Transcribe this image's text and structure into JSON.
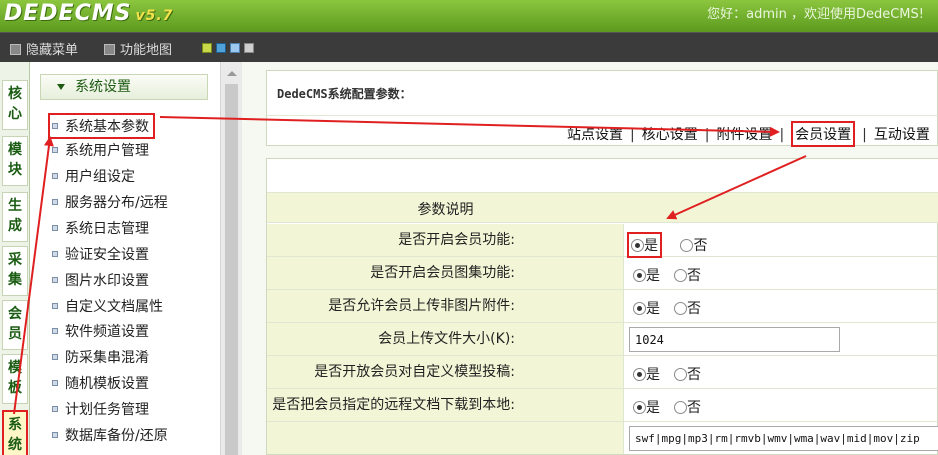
{
  "header": {
    "logo_main": "DEDECMS",
    "logo_version": "v5.7",
    "welcome": "您好：admin ，欢迎使用DedeCMS!"
  },
  "toolbar": {
    "hide_menu": "隐藏菜单",
    "func_map": "功能地图",
    "swatches": [
      "#c9d94a",
      "#4fa3d9",
      "#9fc8ee",
      "#cfcfcf"
    ]
  },
  "vtabs": [
    "核心",
    "模块",
    "生成",
    "采集",
    "会员",
    "模板",
    "系统"
  ],
  "menu": {
    "heading": "系统设置",
    "items": [
      "系统基本参数",
      "系统用户管理",
      "用户组设定",
      "服务器分布/远程",
      "系统日志管理",
      "验证安全设置",
      "图片水印设置",
      "自定义文档属性",
      "软件频道设置",
      "防采集串混淆",
      "随机模板设置",
      "计划任务管理",
      "数据库备份/还原"
    ]
  },
  "content": {
    "title": "DedeCMS系统配置参数：",
    "tabs": [
      "站点设置",
      "核心设置",
      "附件设置",
      "会员设置",
      "互动设置"
    ],
    "table_header": "参数说明",
    "yes": "是",
    "no": "否",
    "rows": [
      {
        "label": "是否开启会员功能:"
      },
      {
        "label": "是否开启会员图集功能:"
      },
      {
        "label": "是否允许会员上传非图片附件:"
      },
      {
        "label": "会员上传文件大小(K):",
        "value": "1024"
      },
      {
        "label": "是否开放会员对自定义模型投稿:"
      },
      {
        "label": "是否把会员指定的远程文档下载到本地:"
      },
      {
        "label": "",
        "value": "swf|mpg|mp3|rm|rmvb|wmv|wma|wav|mid|mov|zip"
      }
    ]
  },
  "colors": {
    "header_green": "#6fae2a",
    "toolbar_dark": "#3b3b3b",
    "highlight_red": "#e02020",
    "label_bg": "#f3f6d6"
  }
}
